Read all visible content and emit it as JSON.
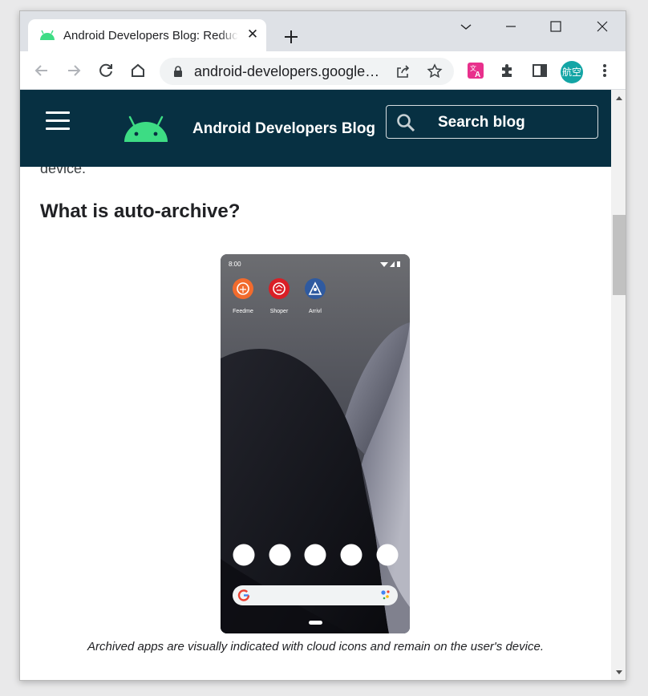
{
  "browser": {
    "tab_title": "Android Developers Blog: Reduce",
    "tab_close_icon": "close-icon",
    "url": "android-developers.googleblog.com",
    "profile_label": "航空"
  },
  "site": {
    "blog_title": "Android Developers Blog",
    "search_label": "Search blog"
  },
  "article": {
    "prev_text": "device.",
    "heading": "What is auto-archive?",
    "caption": "Archived apps are visually indicated with cloud icons and remain on the user's device."
  },
  "phone": {
    "time": "8:00",
    "apps": [
      {
        "label": "Feedme",
        "color": "#f26b2d"
      },
      {
        "label": "Shoper",
        "color": "#d91f26"
      },
      {
        "label": "Arrivl",
        "color": "#2f5aa0"
      }
    ]
  },
  "colors": {
    "header_bg": "#073042",
    "android_green": "#3ddc84"
  }
}
